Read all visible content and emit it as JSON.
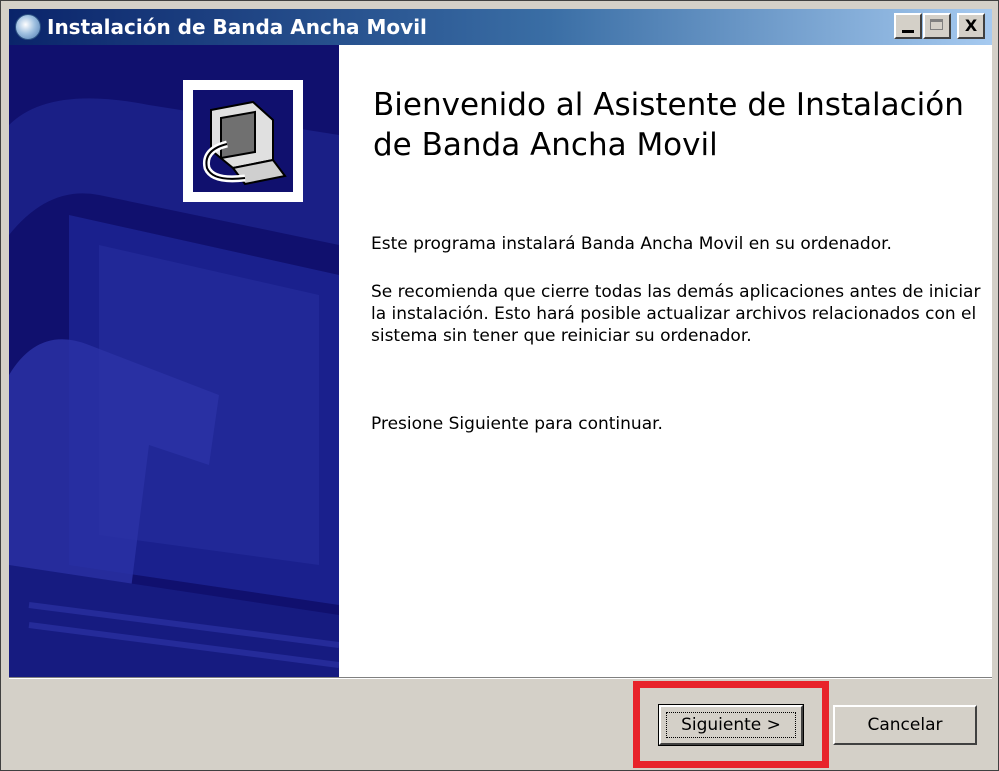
{
  "window": {
    "title": "Instalación de Banda Ancha Movil",
    "icon": "installer-globe-icon"
  },
  "title_buttons": {
    "minimize": "minimize-icon",
    "maximize": "maximize-icon",
    "close_label": "X"
  },
  "welcome": {
    "heading": "Bienvenido al Asistente de Instalación de Banda Ancha Movil",
    "paragraph1": "Este programa instalará Banda Ancha Movil en su ordenador.",
    "paragraph2": "Se recomienda que cierre todas las demás aplicaciones antes de iniciar la instalación. Esto hará posible actualizar archivos relacionados con el sistema sin tener que reiniciar su ordenador.",
    "paragraph3": "Presione Siguiente para continuar."
  },
  "buttons": {
    "next": "Siguiente >",
    "cancel": "Cancelar"
  },
  "colors": {
    "side_panel": "#10106e",
    "highlight": "#e8222a"
  }
}
